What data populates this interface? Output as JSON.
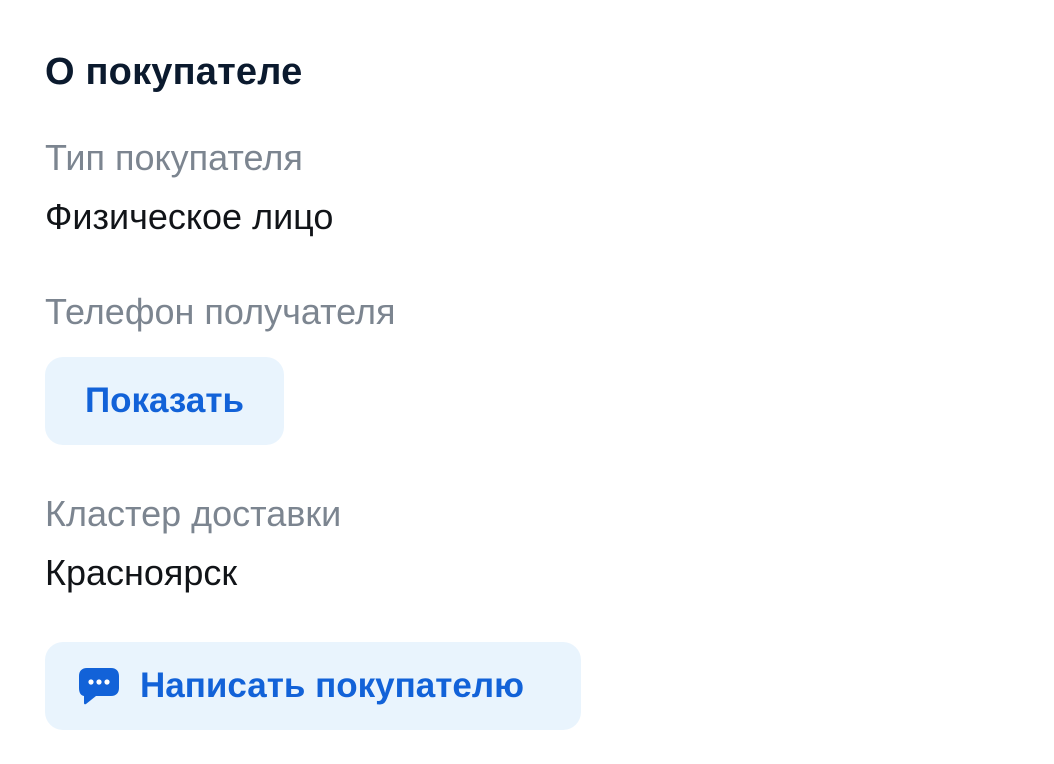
{
  "section": {
    "title": "О покупателе"
  },
  "buyer_type": {
    "label": "Тип покупателя",
    "value": "Физическое лицо"
  },
  "phone": {
    "label": "Телефон получателя",
    "show_button_label": "Показать"
  },
  "delivery_cluster": {
    "label": "Кластер доставки",
    "value": "Красноярск"
  },
  "message_button": {
    "label": "Написать покупателю",
    "icon": "chat-bubble-icon"
  },
  "colors": {
    "accent": "#1262d8",
    "button_background": "#e9f4fd",
    "label_gray": "#7c8590",
    "title": "#0b1a2e"
  }
}
